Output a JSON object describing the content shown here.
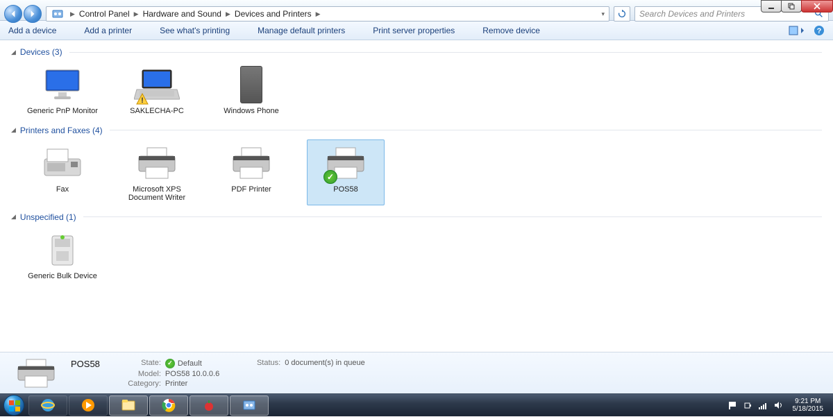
{
  "window_controls": {
    "minimize": "–",
    "maximize": "❐",
    "close": "✕"
  },
  "breadcrumb": {
    "root_icon": "control-panel-icon",
    "items": [
      "Control Panel",
      "Hardware and Sound",
      "Devices and Printers"
    ]
  },
  "search": {
    "placeholder": "Search Devices and Printers"
  },
  "commands": {
    "add_device": "Add a device",
    "add_printer": "Add a printer",
    "see_printing": "See what's printing",
    "manage_defaults": "Manage default printers",
    "server_props": "Print server properties",
    "remove_device": "Remove device"
  },
  "groups": {
    "devices": {
      "title": "Devices (3)",
      "items": [
        {
          "label": "Generic PnP Monitor",
          "icon": "monitor",
          "warn": false
        },
        {
          "label": "SAKLECHA-PC",
          "icon": "laptop",
          "warn": true
        },
        {
          "label": "Windows Phone",
          "icon": "phone",
          "warn": false
        }
      ]
    },
    "printers": {
      "title": "Printers and Faxes (4)",
      "items": [
        {
          "label": "Fax",
          "icon": "fax",
          "default": false,
          "selected": false
        },
        {
          "label": "Microsoft XPS Document Writer",
          "icon": "printer",
          "default": false,
          "selected": false
        },
        {
          "label": "PDF Printer",
          "icon": "printer",
          "default": false,
          "selected": false
        },
        {
          "label": "POS58",
          "icon": "printer",
          "default": true,
          "selected": true
        }
      ]
    },
    "unspecified": {
      "title": "Unspecified (1)",
      "items": [
        {
          "label": "Generic Bulk Device",
          "icon": "device"
        }
      ]
    }
  },
  "details": {
    "title": "POS58",
    "state_label": "State:",
    "state_value": "Default",
    "model_label": "Model:",
    "model_value": "POS58 10.0.0.6",
    "category_label": "Category:",
    "category_value": "Printer",
    "status_label": "Status:",
    "status_value": "0 document(s) in queue"
  },
  "systray": {
    "time": "9:21 PM",
    "date": "5/18/2015"
  }
}
